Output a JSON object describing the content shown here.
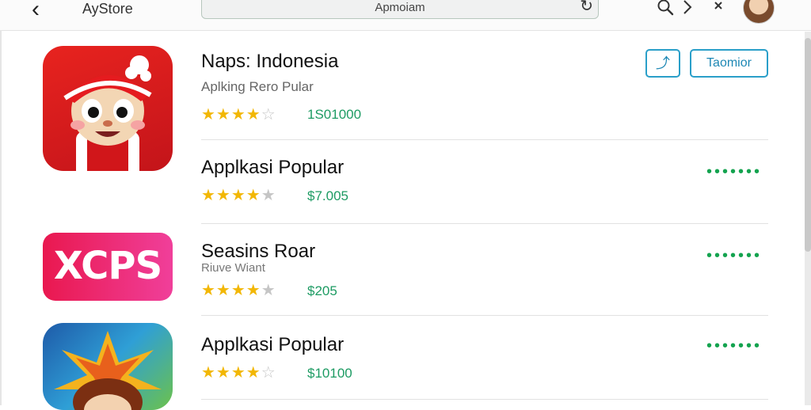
{
  "header": {
    "back_icon": "chevron-left-icon",
    "store_name": "AyStore",
    "search_value": "Apmoiam",
    "refresh_icon": "refresh-icon"
  },
  "featured": {
    "title": "Naps: Indonesia",
    "subtitle": "Aplking Rero Pular",
    "rating": 4,
    "price": "1S01000",
    "share_label": "⤴",
    "action_label": "Taomior"
  },
  "apps": [
    {
      "title": "Applkasi Popular",
      "subtitle": "",
      "rating": 4,
      "price": "$7.005"
    },
    {
      "title": "Seasins Roar",
      "subtitle": "Riuve Wiant",
      "rating": 4,
      "price": "$205"
    },
    {
      "title": "Applkasi Popular",
      "subtitle": "",
      "rating": 4,
      "price": "$10100"
    }
  ],
  "icons": {
    "icon1_text": "",
    "icon2_text": "XCPS"
  },
  "colors": {
    "accent": "#2a9fc9",
    "price": "#1d9b63",
    "star": "#f2b705",
    "dots": "#14a34f"
  }
}
